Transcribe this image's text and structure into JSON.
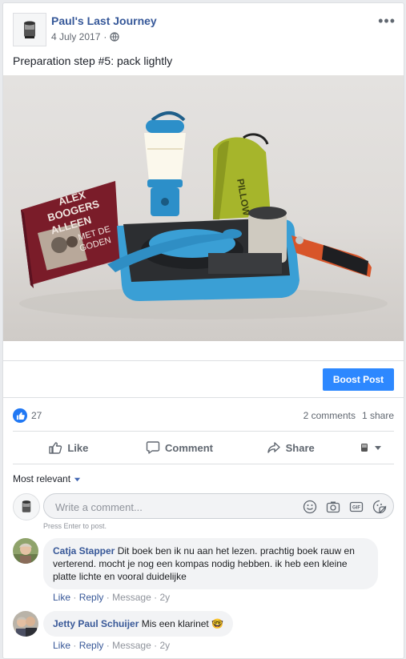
{
  "post": {
    "page_name": "Paul's Last Journey",
    "date": "4 July 2017",
    "separator": "·",
    "privacy_icon": "globe-icon",
    "more_icon": "•••",
    "text": "Preparation step #5: pack lightly",
    "photo_text": {
      "book_line1": "ALEX",
      "book_line2": "BOOGERS",
      "book_line3": "ALLEEN",
      "book_line4": "MET DE",
      "book_line5": "GODEN",
      "bag_text": "PILLOW"
    }
  },
  "boost_label": "Boost Post",
  "reactions": {
    "count": "27",
    "comments": "2 comments",
    "shares": "1 share"
  },
  "actions": {
    "like": "Like",
    "comment": "Comment",
    "share": "Share"
  },
  "sort_label": "Most relevant",
  "composer": {
    "placeholder": "Write a comment...",
    "hint": "Press Enter to post."
  },
  "comments": [
    {
      "author": "Catja Stapper",
      "text": "Dit boek ben ik nu aan het lezen. prachtig boek rauw en verterend. mocht je nog een kompas nodig hebben. ik heb een kleine platte lichte en vooral duidelijke",
      "like": "Like",
      "reply": "Reply",
      "message": "Message",
      "age": "2y",
      "dot": "·"
    },
    {
      "author": "Jetty Paul Schuijer",
      "text": "Mis een klarinet",
      "emoji": "🤓",
      "like": "Like",
      "reply": "Reply",
      "message": "Message",
      "age": "2y",
      "dot": "·"
    }
  ],
  "colors": {
    "link_blue": "#365899",
    "boost_blue": "#2d88ff",
    "like_blue": "#2078f4",
    "lamp_blue": "#2c8fc9",
    "tray_blue": "#3a9fd5",
    "bag_green": "#a6b52b",
    "book_red": "#8a2230",
    "knife_orange": "#d8552a"
  }
}
